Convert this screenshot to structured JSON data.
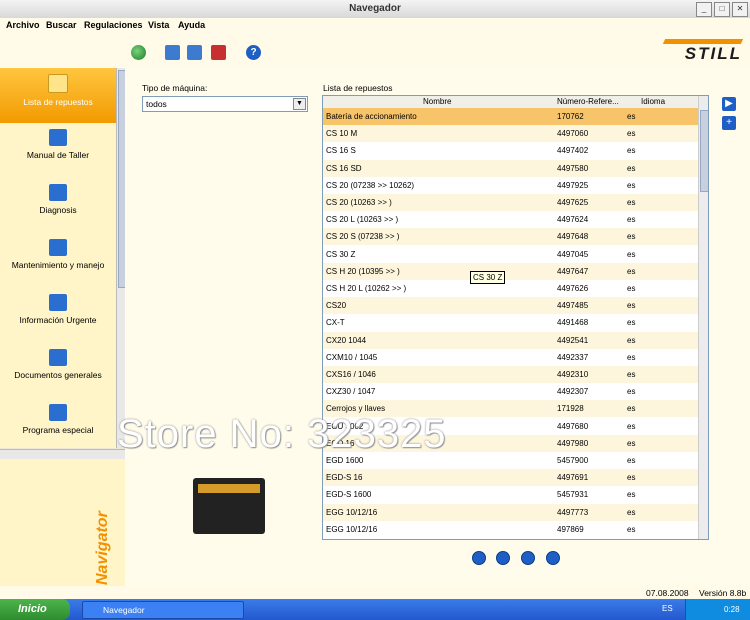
{
  "window": {
    "title": "Navegador"
  },
  "menu": [
    "Archivo",
    "Buscar",
    "Regulaciones",
    "Vista",
    "Ayuda"
  ],
  "logo": "STILL",
  "nav_items": [
    {
      "label": "Lista de repuestos",
      "selected": true
    },
    {
      "label": "Manual de Taller",
      "selected": false
    },
    {
      "label": "Diagnosis",
      "selected": false
    },
    {
      "label": "Mantenimiento y manejo",
      "selected": false
    },
    {
      "label": "Información Urgente",
      "selected": false
    },
    {
      "label": "Documentos generales",
      "selected": false
    },
    {
      "label": "Programa especial",
      "selected": false
    }
  ],
  "nav_brand": "Navigator",
  "filter": {
    "label": "Tipo de máquina:",
    "value": "todos"
  },
  "list": {
    "label": "Lista de repuestos",
    "columns": [
      "Nombre",
      "Número-Refere...",
      "Idioma"
    ],
    "rows": [
      [
        "Batería de accionamiento",
        "170762",
        "es"
      ],
      [
        "CS 10 M",
        "4497060",
        "es"
      ],
      [
        "CS 16 S",
        "4497402",
        "es"
      ],
      [
        "CS 16 SD",
        "4497580",
        "es"
      ],
      [
        "CS 20  (07238 >> 10262)",
        "4497925",
        "es"
      ],
      [
        "CS 20  (10263 >> )",
        "4497625",
        "es"
      ],
      [
        "CS 20 L  (10263 >> )",
        "4497624",
        "es"
      ],
      [
        "CS 20 S  (07238 >> )",
        "4497648",
        "es"
      ],
      [
        "CS 30 Z",
        "4497045",
        "es"
      ],
      [
        "CS H 20  (10395 >> )",
        "4497647",
        "es"
      ],
      [
        "CS H 20 L  (10262 >> )",
        "4497626",
        "es"
      ],
      [
        "CS20",
        "4497485",
        "es"
      ],
      [
        "CX-T",
        "4491468",
        "es"
      ],
      [
        "CX20 1044",
        "4492541",
        "es"
      ],
      [
        "CXM10 / 1045",
        "4492337",
        "es"
      ],
      [
        "CXS16 / 1046",
        "4492310",
        "es"
      ],
      [
        "CXZ30 / 1047",
        "4492307",
        "es"
      ],
      [
        "Cerrojos y llaves",
        "171928",
        "es"
      ],
      [
        "EGU 3002",
        "4497680",
        "es"
      ],
      [
        "EGD 16",
        "4497980",
        "es"
      ],
      [
        "EGD 1600",
        "5457900",
        "es"
      ],
      [
        "EGD-S 16",
        "4497691",
        "es"
      ],
      [
        "EGD-S 1600",
        "5457931",
        "es"
      ],
      [
        "EGG 10/12/16",
        "4497773",
        "es"
      ],
      [
        "EGG 10/12/16",
        "497869",
        "es"
      ]
    ],
    "tooltip": "CS 30 Z"
  },
  "watermark": "Store No: 323325",
  "status": {
    "date": "07.08.2008",
    "version": "Versión 8.8b"
  },
  "taskbar": {
    "start": "Inicio",
    "task": "Navegador",
    "lang": "ES",
    "clock": "0:28"
  }
}
